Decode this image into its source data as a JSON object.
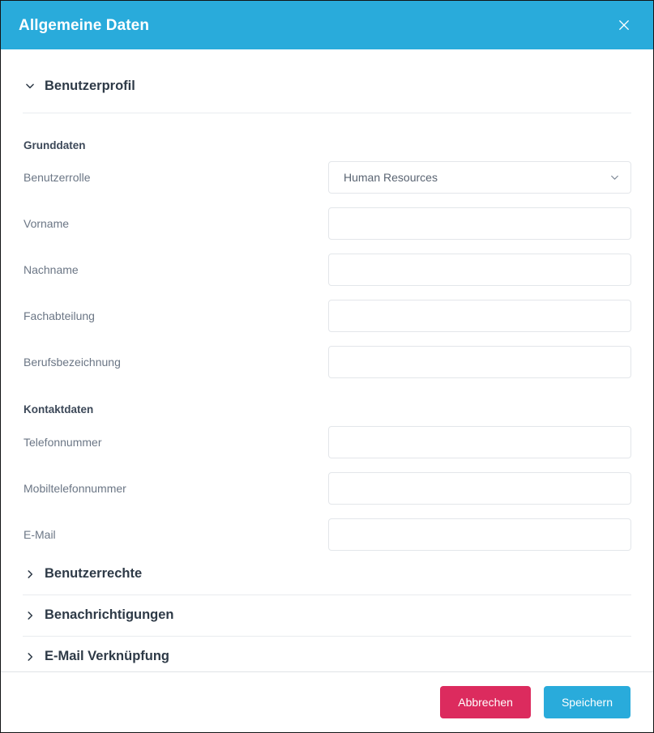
{
  "dialog": {
    "title": "Allgemeine Daten",
    "close_icon": "close-icon",
    "header_color": "#29abdb"
  },
  "sections": {
    "profile": {
      "title": "Benutzerprofil",
      "chevron_icon": "chevron-down-icon",
      "expanded": true,
      "groups": [
        {
          "title": "Grunddaten",
          "fields": [
            {
              "label": "Benutzerrolle",
              "type": "select",
              "value": "Human Resources",
              "placeholder": "",
              "caret_icon": "chevron-down-icon"
            },
            {
              "label": "Vorname",
              "type": "text",
              "value": "",
              "placeholder": ""
            },
            {
              "label": "Nachname",
              "type": "text",
              "value": "",
              "placeholder": ""
            },
            {
              "label": "Fachabteilung",
              "type": "text",
              "value": "",
              "placeholder": ""
            },
            {
              "label": "Berufsbezeichnung",
              "type": "text",
              "value": "",
              "placeholder": ""
            }
          ]
        },
        {
          "title": "Kontaktdaten",
          "fields": [
            {
              "label": "Telefonnummer",
              "type": "text",
              "value": "",
              "placeholder": ""
            },
            {
              "label": "Mobiltelefonnummer",
              "type": "text",
              "value": "",
              "placeholder": ""
            },
            {
              "label": "E-Mail",
              "type": "text",
              "value": "",
              "placeholder": ""
            }
          ]
        }
      ]
    },
    "collapsed": [
      {
        "title": "Benutzerrechte",
        "chevron_icon": "chevron-right-icon",
        "expanded": false
      },
      {
        "title": "Benachrichtigungen",
        "chevron_icon": "chevron-right-icon",
        "expanded": false
      },
      {
        "title": "E-Mail Verknüpfung",
        "chevron_icon": "chevron-right-icon",
        "expanded": false
      }
    ]
  },
  "footer": {
    "cancel_label": "Abbrechen",
    "save_label": "Speichern",
    "cancel_color": "#dc2b5e",
    "save_color": "#29abdb"
  }
}
